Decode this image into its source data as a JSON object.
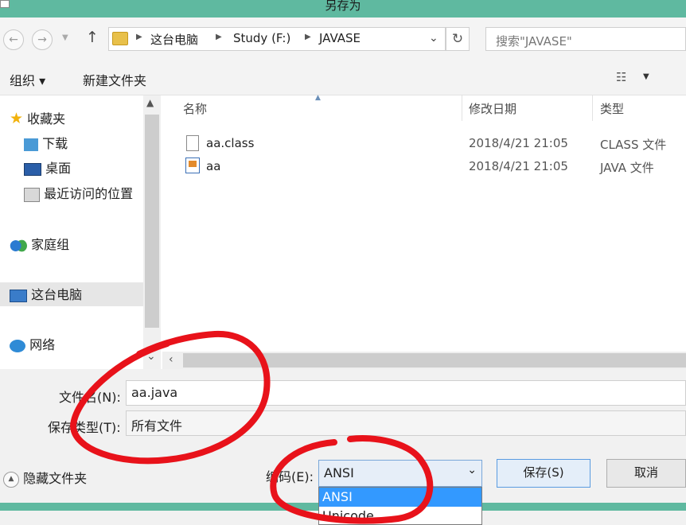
{
  "window": {
    "title": "另存为"
  },
  "nav": {
    "back_glyph": "←",
    "forward_glyph": "→",
    "up_glyph": "↑",
    "refresh_glyph": "↻",
    "breadcrumb": [
      "这台电脑",
      "Study (F:)",
      "JAVASE"
    ],
    "search_placeholder": "搜索\"JAVASE\""
  },
  "toolbar": {
    "organize": "组织 ▾",
    "new_folder": "新建文件夹"
  },
  "sidebar": {
    "favorites": "收藏夹",
    "downloads": "下载",
    "desktop": "桌面",
    "recent": "最近访问的位置",
    "homegroup": "家庭组",
    "this_pc": "这台电脑",
    "network": "网络"
  },
  "columns": {
    "name": "名称",
    "modified": "修改日期",
    "type": "类型"
  },
  "files": [
    {
      "name": "aa.class",
      "date": "2018/4/21 21:05",
      "type": "CLASS 文件",
      "icon": "blank-file-icon"
    },
    {
      "name": "aa",
      "date": "2018/4/21 21:05",
      "type": "JAVA 文件",
      "icon": "java-file-icon"
    }
  ],
  "form": {
    "filename_label": "文件名(N):",
    "filename_value": "aa.java",
    "filetype_label": "保存类型(T):",
    "filetype_value": "所有文件",
    "encoding_label": "编码(E):",
    "encoding_value": "ANSI",
    "encoding_options": [
      "ANSI",
      "Unicode"
    ]
  },
  "footer": {
    "hide_folders": "隐藏文件夹",
    "save": "保存(S)",
    "cancel": "取消"
  },
  "colors": {
    "title_bar": "#5fb9a0",
    "selection": "#3399ff",
    "annotation": "#e8121a"
  }
}
